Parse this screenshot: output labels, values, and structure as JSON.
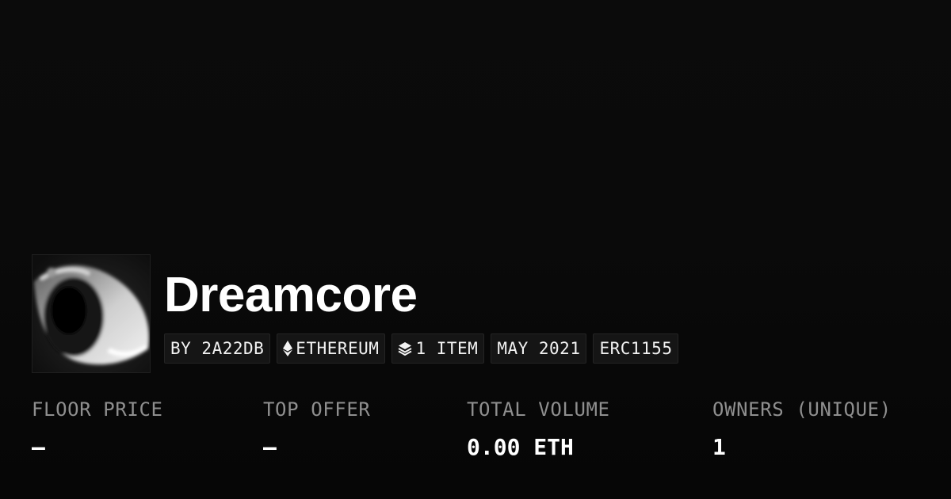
{
  "collection": {
    "title": "Dreamcore",
    "avatar_icon": "eye-artwork",
    "tags": {
      "creator": "BY 2A22DB",
      "chain": "ETHEREUM",
      "chain_icon": "ethereum-icon",
      "items": "1 ITEM",
      "items_icon": "layers-icon",
      "date": "MAY 2021",
      "standard": "ERC1155"
    }
  },
  "stats": {
    "floor_price": {
      "label": "FLOOR PRICE",
      "value": "—"
    },
    "top_offer": {
      "label": "TOP OFFER",
      "value": "—"
    },
    "total_volume": {
      "label": "TOTAL VOLUME",
      "value": "0.00 ETH"
    },
    "owners": {
      "label": "OWNERS (UNIQUE)",
      "value": "1"
    }
  },
  "colors": {
    "background": "#0a0a0a",
    "tag_background": "#151515",
    "label_gray": "#8f8f8f",
    "text": "#ffffff"
  }
}
